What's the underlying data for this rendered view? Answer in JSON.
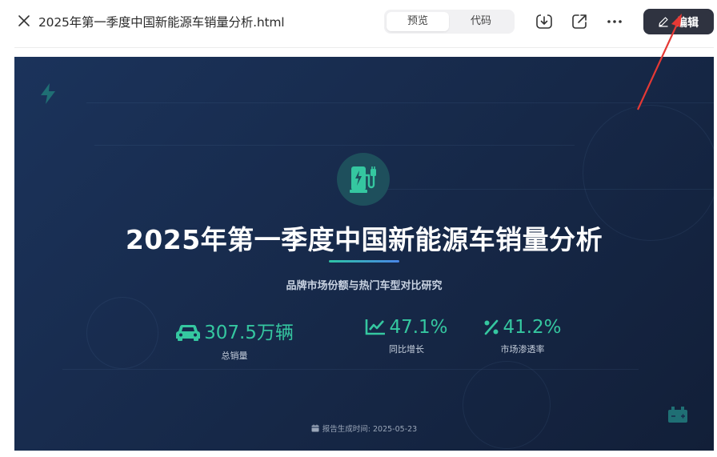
{
  "window": {
    "file_title": "2025年第一季度中国新能源车销量分析.html",
    "tabs": [
      {
        "label": "预览",
        "active": true
      },
      {
        "label": "代码",
        "active": false
      }
    ],
    "edit_label": "编辑"
  },
  "slide": {
    "title": "2025年第一季度中国新能源车销量分析",
    "subtitle": "品牌市场份额与热门车型对比研究",
    "stats": [
      {
        "icon": "car-icon",
        "value": "307.5万辆",
        "label": "总销量"
      },
      {
        "icon": "line-chart-icon",
        "value": "47.1%",
        "label": "同比增长"
      },
      {
        "icon": "percent-icon",
        "value": "41.2%",
        "label": "市场渗透率"
      }
    ],
    "footer": "报告生成时间: 2025-05-23"
  },
  "colors": {
    "accent": "#35c7a0",
    "slide_bg": "#172a4b",
    "edit_button": "#2f3340",
    "annotation_arrow": "#e53935"
  }
}
